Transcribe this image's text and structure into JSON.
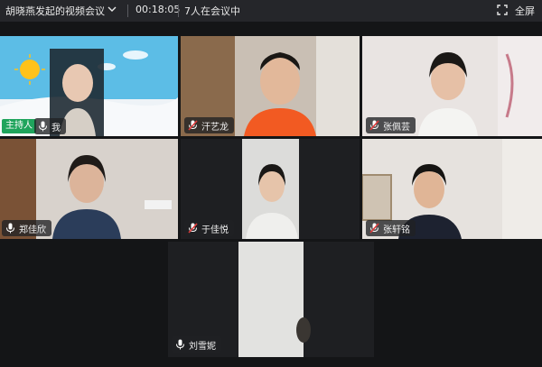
{
  "window": {
    "meeting_title": "胡晓燕发起的视频会议",
    "timer": "00:18:05",
    "participant_count": "7人在会议中",
    "fullscreen_label": "全屏"
  },
  "participants": [
    {
      "name": "我",
      "host_badge": "主持人",
      "mic": "on"
    },
    {
      "name": "汗艺龙",
      "mic": "muted"
    },
    {
      "name": "张佩芸",
      "mic": "muted"
    },
    {
      "name": "郑佳欣",
      "mic": "on"
    },
    {
      "name": "于佳悦",
      "mic": "muted"
    },
    {
      "name": "张轩铭",
      "mic": "muted"
    },
    {
      "name": "刘雪妮",
      "mic": "on"
    }
  ],
  "colors": {
    "background": "#1b1c1f",
    "topbar": "#25262a",
    "host_badge": "#1fa45c",
    "mic_muted": "#e03b3b"
  }
}
